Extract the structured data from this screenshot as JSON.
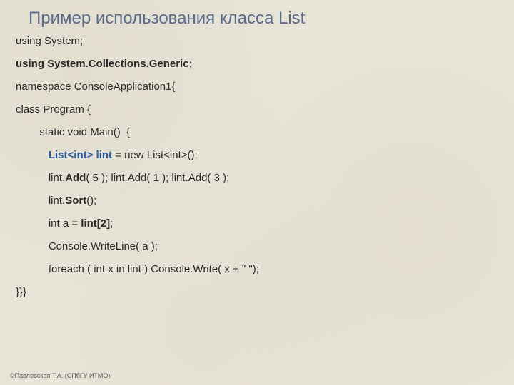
{
  "title": "Пример использования класса List",
  "code": {
    "l1": "using System;",
    "l2": "using System.Collections.Generic;",
    "l3": "namespace ConsoleApplication1{",
    "l4": "class Program {",
    "l5a": "        static void Main()  {",
    "l6_pre": "           ",
    "l6_decl": "List<int> lint",
    "l6_rest": " = new List<int>();",
    "l7_pre": "           lint.",
    "l7_add": "Add",
    "l7_rest": "( 5 ); lint.Add( 1 ); lint.Add( 3 );",
    "l8_pre": "           lint.",
    "l8_sort": "Sort",
    "l8_rest": "();",
    "l9_pre": "           int a = ",
    "l9_idx": "lint[2]",
    "l9_rest": ";",
    "l10": "           Console.WriteLine( a );",
    "l11": "           foreach ( int x in lint ) Console.Write( x + \" \");",
    "l12": "}}}"
  },
  "footer": "©Павловская Т.А. (СПбГУ ИТМО)"
}
